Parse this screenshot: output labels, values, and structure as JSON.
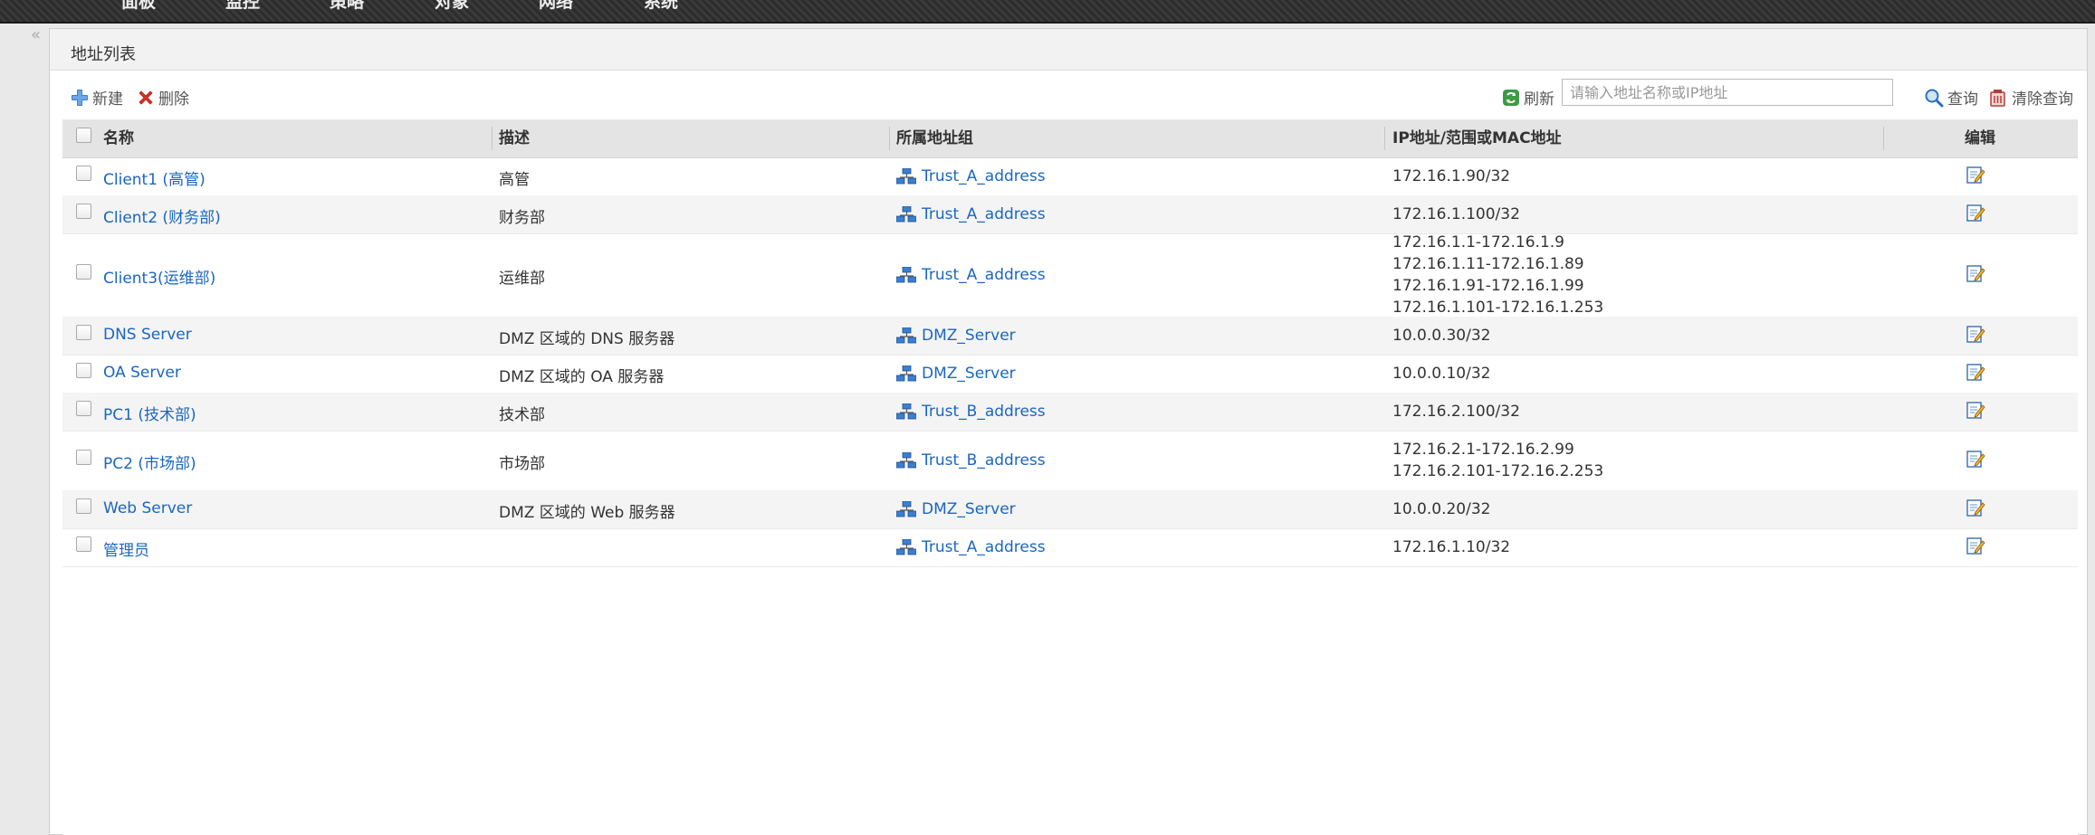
{
  "nav": [
    "面板",
    "监控",
    "策略",
    "对象",
    "网络",
    "系统"
  ],
  "collapse_glyph": "«",
  "panel": {
    "title": "地址列表"
  },
  "toolbar": {
    "new_label": "新建",
    "delete_label": "删除",
    "refresh_label": "刷新",
    "search_placeholder": "请输入地址名称或IP地址",
    "query_label": "查询",
    "clear_query_label": "清除查询"
  },
  "table": {
    "columns": [
      "名称",
      "描述",
      "所属地址组",
      "IP地址/范围或MAC地址",
      "编辑"
    ],
    "rows": [
      {
        "name": "Client1 (高管)",
        "desc": "高管",
        "group": "Trust_A_address",
        "ips": [
          "172.16.1.90/32"
        ]
      },
      {
        "name": "Client2 (财务部)",
        "desc": "财务部",
        "group": "Trust_A_address",
        "ips": [
          "172.16.1.100/32"
        ]
      },
      {
        "name": "Client3(运维部)",
        "desc": "运维部",
        "group": "Trust_A_address",
        "ips": [
          "172.16.1.1-172.16.1.9",
          "172.16.1.11-172.16.1.89",
          "172.16.1.91-172.16.1.99",
          "172.16.1.101-172.16.1.253"
        ]
      },
      {
        "name": "DNS Server",
        "desc": "DMZ 区域的 DNS 服务器",
        "group": "DMZ_Server",
        "ips": [
          "10.0.0.30/32"
        ]
      },
      {
        "name": "OA Server",
        "desc": "DMZ 区域的 OA 服务器",
        "group": "DMZ_Server",
        "ips": [
          "10.0.0.10/32"
        ]
      },
      {
        "name": "PC1 (技术部)",
        "desc": "技术部",
        "group": "Trust_B_address",
        "ips": [
          "172.16.2.100/32"
        ]
      },
      {
        "name": "PC2 (市场部)",
        "desc": "市场部",
        "group": "Trust_B_address",
        "ips": [
          "172.16.2.1-172.16.2.99",
          "172.16.2.101-172.16.2.253"
        ]
      },
      {
        "name": "Web Server",
        "desc": "DMZ 区域的 Web 服务器",
        "group": "DMZ_Server",
        "ips": [
          "10.0.0.20/32"
        ]
      },
      {
        "name": "管理员",
        "desc": "",
        "group": "Trust_A_address",
        "ips": [
          "172.16.1.10/32"
        ]
      }
    ]
  }
}
